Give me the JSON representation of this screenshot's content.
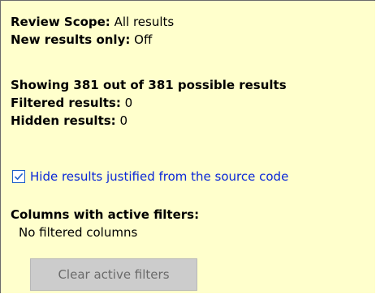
{
  "review_scope": {
    "label": "Review Scope:",
    "value": "All results"
  },
  "new_results_only": {
    "label": "New results only:",
    "value": "Off"
  },
  "showing": {
    "label": "Showing 381 out of 381 possible results"
  },
  "filtered_results": {
    "label": "Filtered results:",
    "value": "0"
  },
  "hidden_results": {
    "label": "Hidden results:",
    "value": "0"
  },
  "hide_justified": {
    "label": "Hide results justified from the source code",
    "checked": true
  },
  "columns_filters": {
    "label": "Columns with active filters:",
    "status": "No filtered columns"
  },
  "clear_button": {
    "label": "Clear active filters",
    "enabled": false
  },
  "colors": {
    "panel_bg": "#ffffcc",
    "checkbox_text": "#0a27d8",
    "button_bg": "#cccccc",
    "button_text": "#6a6a6a"
  },
  "icons": {
    "checkbox": "checkmark-icon"
  }
}
